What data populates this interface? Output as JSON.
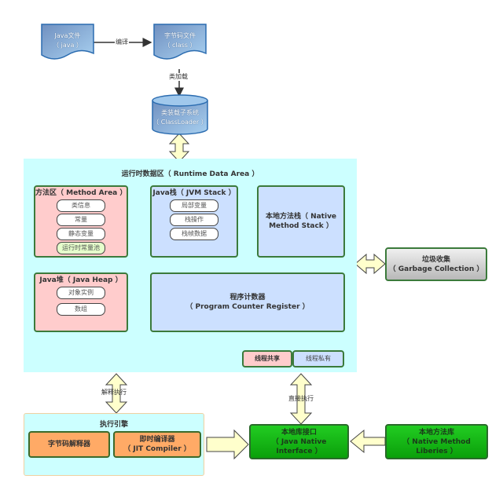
{
  "source_files": {
    "java_file": {
      "line1": "Java文件",
      "line2": "（ java ）"
    },
    "class_file": {
      "line1": "字节码文件",
      "line2": "（ class ）"
    },
    "compile_label": "编译",
    "class_load_label": "类加载"
  },
  "class_loader": {
    "line1": "类装载子系统",
    "line2": "（ ClassLoader ）"
  },
  "runtime_data_area": {
    "title": "运行时数据区（ Runtime Data Area ）",
    "method_area": {
      "title": "方法区（ Method Area ）",
      "items": [
        "类信息",
        "常量",
        "静态变量",
        "运行时常量池"
      ]
    },
    "jvm_stack": {
      "title": "Java栈（ JVM Stack ）",
      "items": [
        "局部变量",
        "栈操作",
        "栈帧数据"
      ]
    },
    "native_method_stack": {
      "line1": "本地方法栈（ Native",
      "line2": "Method Stack ）"
    },
    "java_heap": {
      "title": "Java堆（ Java Heap ）",
      "items": [
        "对象实例",
        "数组"
      ]
    },
    "program_counter": {
      "line1": "程序计数器",
      "line2": "（ Program Counter Register ）"
    },
    "legend": {
      "shared": "线程共享",
      "private": "线程私有"
    }
  },
  "garbage_collection": {
    "line1": "垃圾收集",
    "line2": "（ Garbage Collection ）"
  },
  "interpret_label": "解释执行",
  "direct_exec_label": "直接执行",
  "execution_engine": {
    "title": "执行引擎",
    "bytecode_interpreter": "字节码解释器",
    "jit": {
      "line1": "即时编译器",
      "line2": "（ JIT Compiler ）"
    }
  },
  "jni": {
    "line1": "本地库接口",
    "line2": "（ Java Native",
    "line3": "Interface ）"
  },
  "native_libs": {
    "line1": "本地方法库",
    "line2": "（ Native Method",
    "line3": "Liberies ）"
  },
  "colors": {
    "runtime_bg": "#ccffff",
    "shared": "#ffcccc",
    "private": "#cce0ff",
    "engine_part": "#ffaa66",
    "native": "#22cc22",
    "arrow_fill": "#ffffcc"
  }
}
